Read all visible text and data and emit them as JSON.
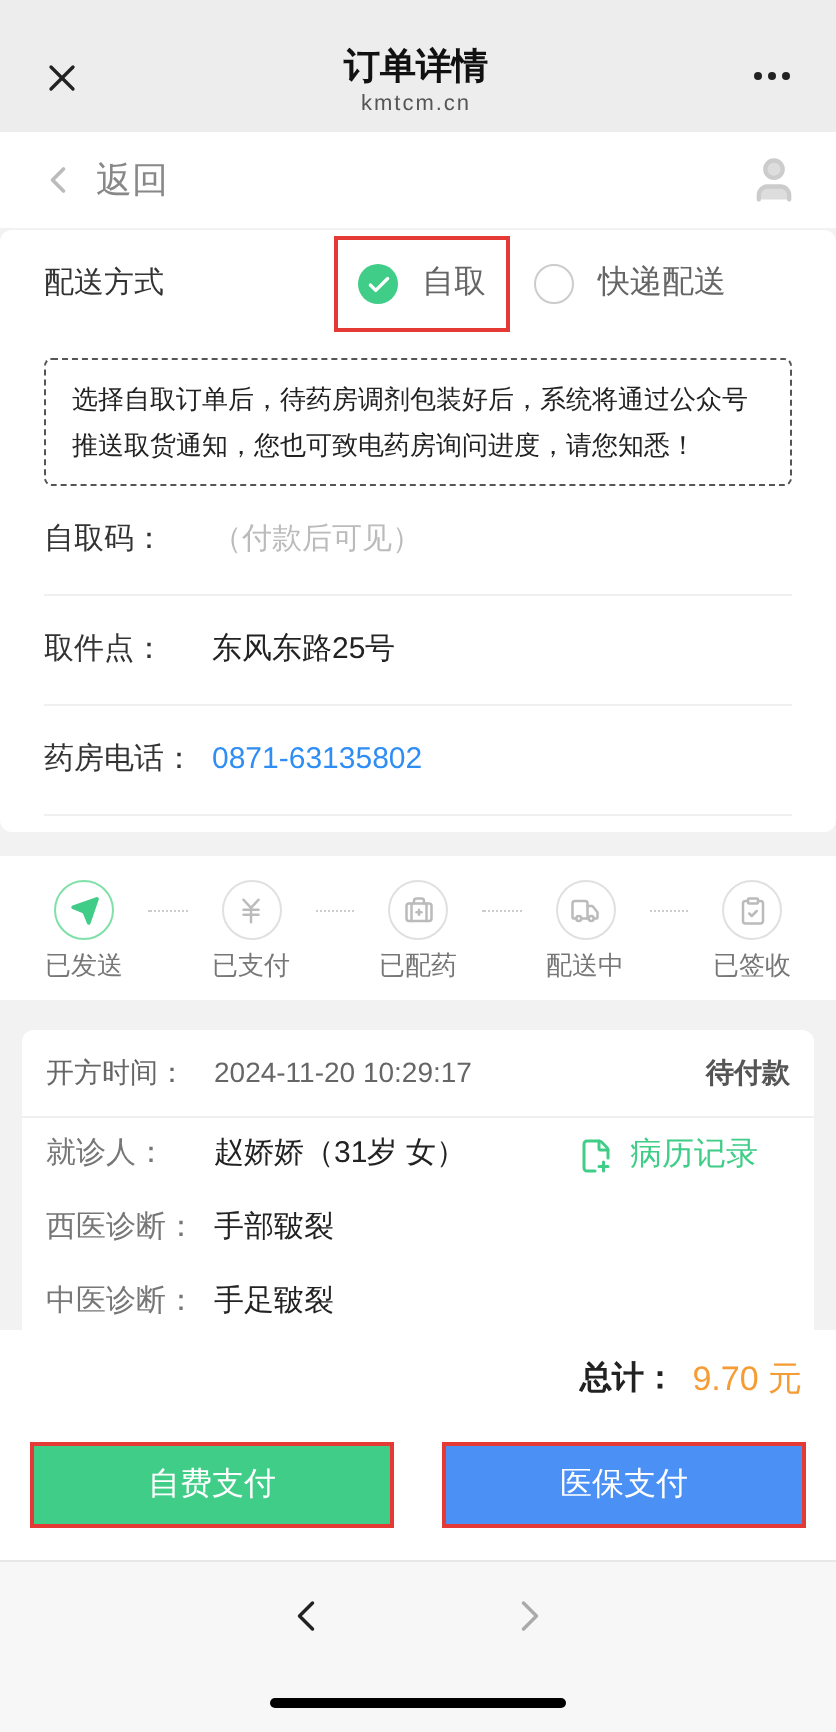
{
  "header": {
    "title": "订单详情",
    "domain": "kmtcm.cn"
  },
  "back": {
    "label": "返回"
  },
  "delivery": {
    "label": "配送方式",
    "options": [
      {
        "label": "自取",
        "selected": true,
        "highlighted": true
      },
      {
        "label": "快递配送",
        "selected": false,
        "highlighted": false
      }
    ],
    "notice": "选择自取订单后，待药房调剂包装好后，系统将通过公众号推送取货通知，您也可致电药房询问进度，请您知悉！"
  },
  "pickup_fields": [
    {
      "label": "自取码：",
      "value": "（付款后可见）",
      "kind": "hint"
    },
    {
      "label": "取件点：",
      "value": "东风东路25号",
      "kind": "text"
    },
    {
      "label": "药房电话：",
      "value": "0871-63135802",
      "kind": "phone"
    }
  ],
  "steps": [
    {
      "label": "已发送",
      "done": true,
      "kind": "send"
    },
    {
      "label": "已支付",
      "done": false,
      "kind": "yen"
    },
    {
      "label": "已配药",
      "done": false,
      "kind": "medicine"
    },
    {
      "label": "配送中",
      "done": false,
      "kind": "truck"
    },
    {
      "label": "已签收",
      "done": false,
      "kind": "clipboard"
    }
  ],
  "prescription": {
    "time_label": "开方时间：",
    "time": "2024-11-20 10:29:17",
    "status": "待付款",
    "record_link": "病历记录",
    "rows": [
      {
        "label": "就诊人：",
        "value": "赵娇娇（31岁 女）"
      },
      {
        "label": "西医诊断：",
        "value": "手部皲裂"
      },
      {
        "label": "中医诊断：",
        "value": "手足皲裂"
      }
    ]
  },
  "total": {
    "label": "总计：",
    "amount": "9.70 元"
  },
  "buttons": [
    {
      "label": "自费支付",
      "kind": "green",
      "highlighted": true
    },
    {
      "label": "医保支付",
      "kind": "blue",
      "highlighted": true
    }
  ]
}
